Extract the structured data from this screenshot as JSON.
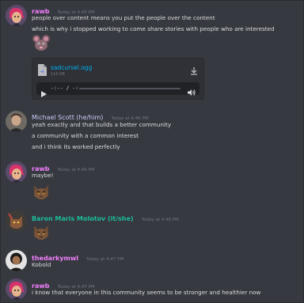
{
  "messages": [
    {
      "author": "rawb",
      "author_color": "#f47fff",
      "timestamp": "Today at 4:45 PM",
      "lines": [
        "people over content means you put the people over the content",
        "which is why i stopped working to come share stories with people who are interested"
      ],
      "emoji": "rat-emoji",
      "attachment": {
        "filename": "sadcursel.ogg",
        "size": "110 KB",
        "time_display": "-:-- / -:--"
      }
    },
    {
      "author": "Michael Scott (he/him)",
      "author_color": "#c9cdfb",
      "timestamp": "Today at 4:46 PM",
      "lines": [
        "yeah exactly and that builds a better community",
        "a community with a common interest",
        "and i think its worked perfectly"
      ]
    },
    {
      "author": "rawb",
      "author_color": "#f47fff",
      "timestamp": "Today at 4:46 PM",
      "lines": [
        "maybe!"
      ],
      "emoji": "cat-emoji"
    },
    {
      "author": "Baron Maris Molotov (it/she)",
      "author_color": "#1abc9c",
      "timestamp": "Today at 4:46 PM",
      "lines": [],
      "emoji": "cat-emoji"
    },
    {
      "author": "thedarkymwl",
      "author_color": "#f47fff",
      "timestamp": "Today at 4:47 PM",
      "lines": [
        "Kobold"
      ]
    },
    {
      "author": "rawb",
      "author_color": "#f47fff",
      "timestamp": "Today at 4:47 PM",
      "lines": [
        "i know that everyone in this community seems to be stronger and healthier now"
      ]
    }
  ]
}
